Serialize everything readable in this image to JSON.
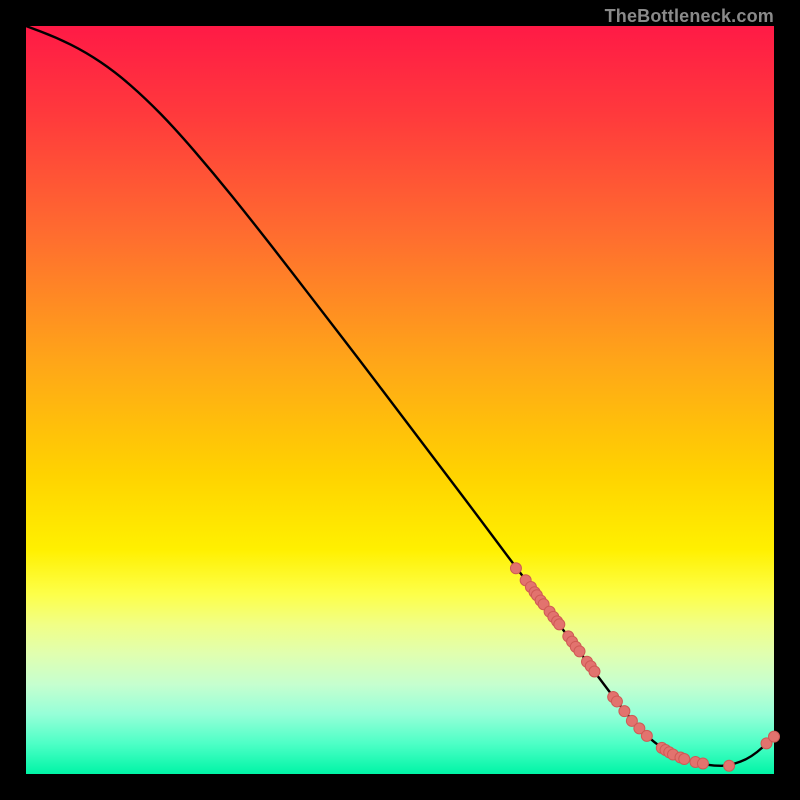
{
  "watermark": "TheBottleneck.com",
  "colors": {
    "curve": "#000000",
    "marker_fill": "#e2736e",
    "marker_stroke": "#cf5a55",
    "gradient_top": "#ff1a46",
    "gradient_bottom": "#00f5a6",
    "page_bg": "#000000"
  },
  "chart_data": {
    "type": "line",
    "title": "",
    "xlabel": "",
    "ylabel": "",
    "xlim": [
      0,
      100
    ],
    "ylim": [
      0,
      100
    ],
    "grid": false,
    "legend": false,
    "series": [
      {
        "name": "bottleneck-curve",
        "x": [
          0,
          4,
          8,
          12,
          16,
          20,
          25,
          30,
          35,
          40,
          45,
          50,
          55,
          60,
          65,
          70,
          75,
          78,
          80,
          82,
          84,
          86,
          88,
          90,
          92,
          94,
          97,
          100
        ],
        "y": [
          100,
          98.5,
          96.5,
          93.8,
          90.3,
          86.2,
          80.4,
          74.2,
          67.8,
          61.3,
          54.8,
          48.2,
          41.6,
          35.0,
          28.3,
          21.7,
          15.0,
          11.0,
          8.4,
          6.1,
          4.2,
          2.9,
          2.0,
          1.4,
          1.1,
          1.1,
          2.2,
          5.0
        ]
      }
    ],
    "markers": {
      "name": "sample-points",
      "x": [
        65.5,
        66.8,
        67.5,
        68.0,
        68.3,
        68.8,
        69.2,
        70.0,
        70.5,
        71.0,
        71.3,
        72.5,
        73.0,
        73.5,
        74.0,
        75.0,
        75.5,
        76.0,
        78.5,
        79.0,
        80.0,
        81.0,
        82.0,
        83.0,
        85.0,
        85.5,
        86.0,
        86.5,
        87.5,
        88.0,
        89.5,
        90.5,
        94.0,
        99.0,
        100.0
      ],
      "y": [
        27.5,
        25.9,
        25.0,
        24.3,
        23.9,
        23.2,
        22.7,
        21.7,
        21.0,
        20.4,
        20.0,
        18.4,
        17.7,
        17.0,
        16.4,
        15.0,
        14.4,
        13.7,
        10.3,
        9.7,
        8.4,
        7.1,
        6.1,
        5.1,
        3.5,
        3.2,
        2.9,
        2.6,
        2.2,
        2.0,
        1.6,
        1.4,
        1.1,
        4.1,
        5.0
      ]
    }
  }
}
